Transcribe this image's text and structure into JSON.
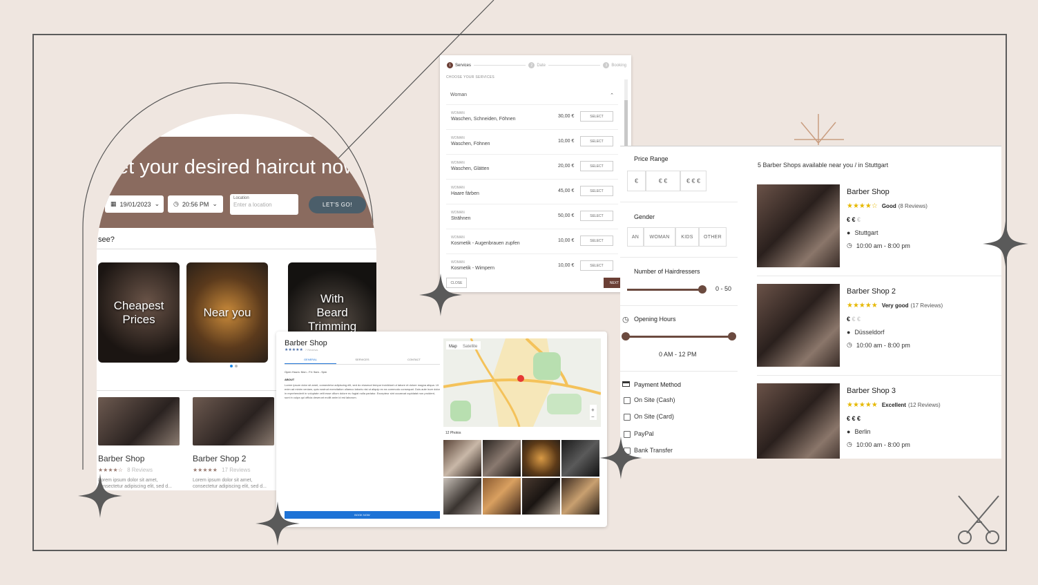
{
  "hero": {
    "title": "et your desired haircut now",
    "date": "19/01/2023",
    "time": "20:56 PM",
    "location_label": "Location",
    "location_placeholder": "Enter a location",
    "cta": "LET'S GO!"
  },
  "section_question": "see?",
  "categories": [
    {
      "label": "Cheapest Prices"
    },
    {
      "label": "Near you"
    },
    {
      "label": "With Beard Trimming"
    }
  ],
  "mini_cards": [
    {
      "name": "Barber Shop",
      "stars": "★★★★☆",
      "reviews": "8 Reviews",
      "desc": "Lorem ipsum dolor sit amet, consectetur adipiscing elit, sed d..."
    },
    {
      "name": "Barber Shop 2",
      "stars": "★★★★★",
      "reviews": "17 Reviews",
      "desc": "Lorem ipsum dolor sit amet, consectetur adipiscing elit, sed d..."
    }
  ],
  "services": {
    "steps": [
      "Services",
      "Date",
      "Booking"
    ],
    "step_numbers": [
      "1",
      "2",
      "3"
    ],
    "header": "CHOOSE YOUR SERVICES",
    "group": "Woman",
    "rows": [
      {
        "cat": "WOMAN",
        "name": "Waschen, Schneiden, Föhnen",
        "price": "30,00 €"
      },
      {
        "cat": "WOMAN",
        "name": "Waschen, Föhnen",
        "price": "10,00 €"
      },
      {
        "cat": "WOMAN",
        "name": "Waschen, Glätten",
        "price": "20,00 €"
      },
      {
        "cat": "WOMAN",
        "name": "Haare färben",
        "price": "45,00 €"
      },
      {
        "cat": "WOMAN",
        "name": "Strähnen",
        "price": "50,00 €"
      },
      {
        "cat": "WOMAN",
        "name": "Kosmetik - Augenbrauen zupfen",
        "price": "10,00 €"
      },
      {
        "cat": "WOMAN",
        "name": "Kosmetik - Wimpern",
        "price": "10,00 €"
      }
    ],
    "select_label": "SELECT",
    "close_label": "CLOSE",
    "next_label": "NEXT"
  },
  "filters": {
    "price_title": "Price Range",
    "price_options": [
      "€",
      "€ €",
      "€ € €"
    ],
    "gender_title": "Gender",
    "gender_options": [
      "AN",
      "WOMAN",
      "KIDS",
      "OTHER"
    ],
    "hairdressers_title": "Number of Hairdressers",
    "hairdressers_value": "0 - 50",
    "hours_title": "Opening Hours",
    "hours_value": "0 AM - 12 PM",
    "payment_title": "Payment Method",
    "payment_options": [
      "On Site (Cash)",
      "On Site (Card)",
      "PayPal",
      "Bank Transfer"
    ]
  },
  "results": {
    "summary": "5 Barber Shops available near you / in Stuttgart",
    "shops": [
      {
        "name": "Barber Shop",
        "stars": "★★★★☆",
        "rating": "Good",
        "reviews": "(8 Reviews)",
        "price": "€ €",
        "price_off": "€",
        "city": "Stuttgart",
        "hours": "10:00 am - 8:00 pm"
      },
      {
        "name": "Barber Shop 2",
        "stars": "★★★★★",
        "rating": "Very good",
        "reviews": "(17 Reviews)",
        "price": "€",
        "price_off": "€ €",
        "city": "Düsseldorf",
        "hours": "10:00 am - 8:00 pm"
      },
      {
        "name": "Barber Shop 3",
        "stars": "★★★★★",
        "rating": "Excellent",
        "reviews": "(12 Reviews)",
        "price": "€ € €",
        "price_off": "",
        "city": "Berlin",
        "hours": "10:00 am - 8:00 pm"
      }
    ]
  },
  "detail": {
    "name": "Barber Shop",
    "stars": "★★★★★",
    "reviews": "7 Reviews",
    "tabs": [
      "GENERAL",
      "SERVICES",
      "CONTACT"
    ],
    "hours": "Open Hours: Mon - Fri: 9am - 9pm",
    "about_title": "ABOUT",
    "about_text": "Lorem ipsum dolor sit amet, consectetur adipiscing elit, sed do eiusmod tempor incididunt ut labore et dolore magna aliqua. Ut enim ad minim veniam, quis nostrud exercitation ullamco laboris nisi ut aliquip ex ea commodo consequat. Duis aute irure dolor in reprehenderit in voluptate velit esse cillum dolore eu fugiat nulla pariatur. Excepteur sint occaecat cupidatat non proident, sunt in culpa qui officia deserunt mollit anim id est laborum.",
    "book_label": "BOOK NOW",
    "map_tabs": [
      "Map",
      "Satellite"
    ],
    "photos_label": "12 Photos"
  },
  "colors": {
    "background": "#efe6e0",
    "brown": "#6b4a3f",
    "hero": "#8a6b5f",
    "blue": "#1e73d6",
    "star": "#e6b800"
  }
}
